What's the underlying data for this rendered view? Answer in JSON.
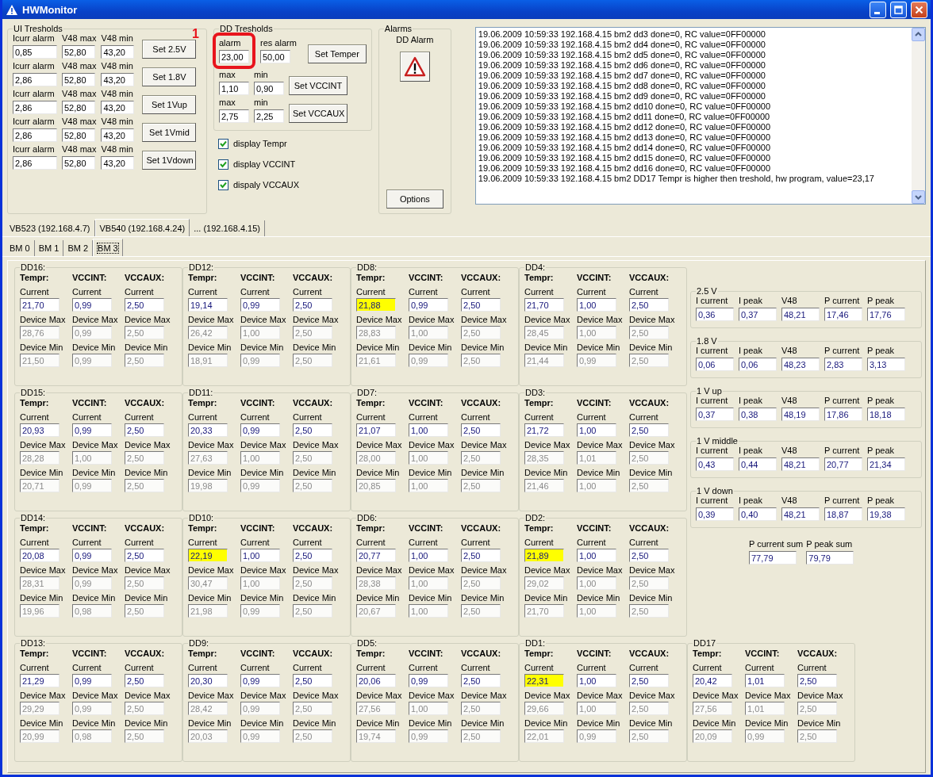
{
  "window": {
    "title": "HWMonitor"
  },
  "ui_thresholds": {
    "title": "UI Tresholds",
    "rows": [
      {
        "labels": [
          "Icurr alarm",
          "V48 max",
          "V48 min"
        ],
        "values": [
          "0,85",
          "52,80",
          "43,20"
        ],
        "button": "Set 2.5V"
      },
      {
        "labels": [
          "Icurr alarm",
          "V48 max",
          "V48 min"
        ],
        "values": [
          "2,86",
          "52,80",
          "43,20"
        ],
        "button": "Set 1.8V"
      },
      {
        "labels": [
          "Icurr alarm",
          "V48 max",
          "V48 min"
        ],
        "values": [
          "2,86",
          "52,80",
          "43,20"
        ],
        "button": "Set 1Vup"
      },
      {
        "labels": [
          "Icurr alarm",
          "V48 max",
          "V48 min"
        ],
        "values": [
          "2,86",
          "52,80",
          "43,20"
        ],
        "button": "Set 1Vmid"
      },
      {
        "labels": [
          "Icurr alarm",
          "V48 max",
          "V48 min"
        ],
        "values": [
          "2,86",
          "52,80",
          "43,20"
        ],
        "button": "Set 1Vdown"
      }
    ]
  },
  "dd_thresholds": {
    "title": "DD Tresholds",
    "annotation": "1",
    "rows": [
      {
        "labels": [
          "alarm",
          "res alarm"
        ],
        "values": [
          "23,00",
          "50,00"
        ],
        "button": "Set Temper"
      },
      {
        "labels": [
          "max",
          "min"
        ],
        "values": [
          "1,10",
          "0,90"
        ],
        "button": "Set VCCINT"
      },
      {
        "labels": [
          "max",
          "min"
        ],
        "values": [
          "2,75",
          "2,25"
        ],
        "button": "Set VCCAUX"
      }
    ]
  },
  "checkboxes": [
    {
      "label": "display Tempr",
      "checked": true
    },
    {
      "label": "display VCCINT",
      "checked": true
    },
    {
      "label": "dispaly VCCAUX",
      "checked": true
    }
  ],
  "alarms": {
    "title": "Alarms",
    "label": "DD Alarm",
    "button": "Options"
  },
  "log": {
    "lines": [
      "19.06.2009 10:59:33 192.168.4.15 bm2 dd3 done=0, RC value=0FF00000",
      "19.06.2009 10:59:33 192.168.4.15 bm2 dd4 done=0, RC value=0FF00000",
      "19.06.2009 10:59:33 192.168.4.15 bm2 dd5 done=0, RC value=0FF00000",
      "19.06.2009 10:59:33 192.168.4.15 bm2 dd6 done=0, RC value=0FF00000",
      "19.06.2009 10:59:33 192.168.4.15 bm2 dd7 done=0, RC value=0FF00000",
      "19.06.2009 10:59:33 192.168.4.15 bm2 dd8 done=0, RC value=0FF00000",
      "19.06.2009 10:59:33 192.168.4.15 bm2 dd9 done=0, RC value=0FF00000",
      "19.06.2009 10:59:33 192.168.4.15 bm2 dd10 done=0, RC value=0FF00000",
      "19.06.2009 10:59:33 192.168.4.15 bm2 dd11 done=0, RC value=0FF00000",
      "19.06.2009 10:59:33 192.168.4.15 bm2 dd12 done=0, RC value=0FF00000",
      "19.06.2009 10:59:33 192.168.4.15 bm2 dd13 done=0, RC value=0FF00000",
      "19.06.2009 10:59:33 192.168.4.15 bm2 dd14 done=0, RC value=0FF00000",
      "19.06.2009 10:59:33 192.168.4.15 bm2 dd15 done=0, RC value=0FF00000",
      "19.06.2009 10:59:33 192.168.4.15 bm2 dd16 done=0, RC value=0FF00000",
      "19.06.2009 10:59:33 192.168.4.15 bm2 DD17 Tempr is higher then treshold, hw program, value=23,17"
    ]
  },
  "tabs": [
    {
      "label": "VB523 (192.168.4.7)",
      "selected": false
    },
    {
      "label": "VB540 (192.168.4.24)",
      "selected": true
    },
    {
      "label": "... (192.168.4.15)",
      "selected": false
    }
  ],
  "subtabs": [
    {
      "label": "BM 0",
      "selected": false
    },
    {
      "label": "BM 1",
      "selected": false
    },
    {
      "label": "BM 2",
      "selected": false
    },
    {
      "label": "BM 3",
      "selected": true
    }
  ],
  "devices": [
    {
      "name": "DD16:",
      "metrics": [
        {
          "header": "Tempr:",
          "labels": [
            "Current",
            "Device Max",
            "Device Min"
          ],
          "values": [
            "21,70",
            "28,76",
            "21,50"
          ],
          "alarm": false
        },
        {
          "header": "VCCINT:",
          "labels": [
            "Current",
            "Device Max",
            "Device Min"
          ],
          "values": [
            "0,99",
            "0,99",
            "0,99"
          ],
          "alarm": false
        },
        {
          "header": "VCCAUX:",
          "labels": [
            "Current",
            "Device Max",
            "Device Min"
          ],
          "values": [
            "2,50",
            "2,50",
            "2,50"
          ],
          "alarm": false
        }
      ]
    },
    {
      "name": "DD12:",
      "metrics": [
        {
          "header": "Tempr:",
          "labels": [
            "Current",
            "Device Max",
            "Device Min"
          ],
          "values": [
            "19,14",
            "26,42",
            "18,91"
          ],
          "alarm": false
        },
        {
          "header": "VCCINT:",
          "labels": [
            "Current",
            "Device Max",
            "Device Min"
          ],
          "values": [
            "0,99",
            "1,00",
            "0,99"
          ],
          "alarm": false
        },
        {
          "header": "VCCAUX:",
          "labels": [
            "Current",
            "Device Max",
            "Device Min"
          ],
          "values": [
            "2,50",
            "2,50",
            "2,50"
          ],
          "alarm": false
        }
      ]
    },
    {
      "name": "DD8:",
      "metrics": [
        {
          "header": "Tempr:",
          "labels": [
            "Current",
            "Device Max",
            "Device Min"
          ],
          "values": [
            "21,88",
            "28,83",
            "21,61"
          ],
          "alarm": true
        },
        {
          "header": "VCCINT:",
          "labels": [
            "Current",
            "Device Max",
            "Device Min"
          ],
          "values": [
            "0,99",
            "1,00",
            "0,99"
          ],
          "alarm": false
        },
        {
          "header": "VCCAUX:",
          "labels": [
            "Current",
            "Device Max",
            "Device Min"
          ],
          "values": [
            "2,50",
            "2,50",
            "2,50"
          ],
          "alarm": false
        }
      ]
    },
    {
      "name": "DD4:",
      "metrics": [
        {
          "header": "Tempr:",
          "labels": [
            "Current",
            "Device Max",
            "Device Min"
          ],
          "values": [
            "21,70",
            "28,45",
            "21,44"
          ],
          "alarm": false
        },
        {
          "header": "VCCINT:",
          "labels": [
            "Current",
            "Device Max",
            "Device Min"
          ],
          "values": [
            "1,00",
            "1,00",
            "0,99"
          ],
          "alarm": false
        },
        {
          "header": "VCCAUX:",
          "labels": [
            "Current",
            "Device Max",
            "Device Min"
          ],
          "values": [
            "2,50",
            "2,50",
            "2,50"
          ],
          "alarm": false
        }
      ]
    },
    {
      "name": "DD15:",
      "metrics": [
        {
          "header": "Tempr:",
          "labels": [
            "Current",
            "Device Max",
            "Device Min"
          ],
          "values": [
            "20,93",
            "28,28",
            "20,71"
          ],
          "alarm": false
        },
        {
          "header": "VCCINT:",
          "labels": [
            "Current",
            "Device Max",
            "Device Min"
          ],
          "values": [
            "0,99",
            "1,00",
            "0,99"
          ],
          "alarm": false
        },
        {
          "header": "VCCAUX:",
          "labels": [
            "Current",
            "Device Max",
            "Device Min"
          ],
          "values": [
            "2,50",
            "2,50",
            "2,50"
          ],
          "alarm": false
        }
      ]
    },
    {
      "name": "DD11:",
      "metrics": [
        {
          "header": "Tempr:",
          "labels": [
            "Current",
            "Device Max",
            "Device Min"
          ],
          "values": [
            "20,33",
            "27,63",
            "19,98"
          ],
          "alarm": false
        },
        {
          "header": "VCCINT:",
          "labels": [
            "Current",
            "Device Max",
            "Device Min"
          ],
          "values": [
            "0,99",
            "1,00",
            "0,99"
          ],
          "alarm": false
        },
        {
          "header": "VCCAUX:",
          "labels": [
            "Current",
            "Device Max",
            "Device Min"
          ],
          "values": [
            "2,50",
            "2,50",
            "2,50"
          ],
          "alarm": false
        }
      ]
    },
    {
      "name": "DD7:",
      "metrics": [
        {
          "header": "Tempr:",
          "labels": [
            "Current",
            "Device Max",
            "Device Min"
          ],
          "values": [
            "21,07",
            "28,00",
            "20,85"
          ],
          "alarm": false
        },
        {
          "header": "VCCINT:",
          "labels": [
            "Current",
            "Device Max",
            "Device Min"
          ],
          "values": [
            "1,00",
            "1,00",
            "1,00"
          ],
          "alarm": false
        },
        {
          "header": "VCCAUX:",
          "labels": [
            "Current",
            "Device Max",
            "Device Min"
          ],
          "values": [
            "2,50",
            "2,50",
            "2,50"
          ],
          "alarm": false
        }
      ]
    },
    {
      "name": "DD3:",
      "metrics": [
        {
          "header": "Tempr:",
          "labels": [
            "Current",
            "Device Max",
            "Device Min"
          ],
          "values": [
            "21,72",
            "28,35",
            "21,46"
          ],
          "alarm": false
        },
        {
          "header": "VCCINT:",
          "labels": [
            "Current",
            "Device Max",
            "Device Min"
          ],
          "values": [
            "1,00",
            "1,01",
            "1,00"
          ],
          "alarm": false
        },
        {
          "header": "VCCAUX:",
          "labels": [
            "Current",
            "Device Max",
            "Device Min"
          ],
          "values": [
            "2,50",
            "2,50",
            "2,50"
          ],
          "alarm": false
        }
      ]
    },
    {
      "name": "DD14:",
      "metrics": [
        {
          "header": "Tempr:",
          "labels": [
            "Current",
            "Device Max",
            "Device Min"
          ],
          "values": [
            "20,08",
            "28,31",
            "19,96"
          ],
          "alarm": false
        },
        {
          "header": "VCCINT:",
          "labels": [
            "Current",
            "Device Max",
            "Device Min"
          ],
          "values": [
            "0,99",
            "0,99",
            "0,98"
          ],
          "alarm": false
        },
        {
          "header": "VCCAUX:",
          "labels": [
            "Current",
            "Device Max",
            "Device Min"
          ],
          "values": [
            "2,50",
            "2,50",
            "2,50"
          ],
          "alarm": false
        }
      ]
    },
    {
      "name": "DD10:",
      "metrics": [
        {
          "header": "Tempr:",
          "labels": [
            "Current",
            "Device Max",
            "Device Min"
          ],
          "values": [
            "22,19",
            "30,47",
            "21,98"
          ],
          "alarm": true
        },
        {
          "header": "VCCINT:",
          "labels": [
            "Current",
            "Device Max",
            "Device Min"
          ],
          "values": [
            "1,00",
            "1,00",
            "0,99"
          ],
          "alarm": false
        },
        {
          "header": "VCCAUX:",
          "labels": [
            "Current",
            "Device Max",
            "Device Min"
          ],
          "values": [
            "2,50",
            "2,50",
            "2,50"
          ],
          "alarm": false
        }
      ]
    },
    {
      "name": "DD6:",
      "metrics": [
        {
          "header": "Tempr:",
          "labels": [
            "Current",
            "Device Max",
            "Device Min"
          ],
          "values": [
            "20,77",
            "28,38",
            "20,67"
          ],
          "alarm": false
        },
        {
          "header": "VCCINT:",
          "labels": [
            "Current",
            "Device Max",
            "Device Min"
          ],
          "values": [
            "1,00",
            "1,00",
            "1,00"
          ],
          "alarm": false
        },
        {
          "header": "VCCAUX:",
          "labels": [
            "Current",
            "Device Max",
            "Device Min"
          ],
          "values": [
            "2,50",
            "2,50",
            "2,50"
          ],
          "alarm": false
        }
      ]
    },
    {
      "name": "DD2:",
      "metrics": [
        {
          "header": "Tempr:",
          "labels": [
            "Current",
            "Device Max",
            "Device Min"
          ],
          "values": [
            "21,89",
            "29,02",
            "21,70"
          ],
          "alarm": true
        },
        {
          "header": "VCCINT:",
          "labels": [
            "Current",
            "Device Max",
            "Device Min"
          ],
          "values": [
            "1,00",
            "1,00",
            "1,00"
          ],
          "alarm": false
        },
        {
          "header": "VCCAUX:",
          "labels": [
            "Current",
            "Device Max",
            "Device Min"
          ],
          "values": [
            "2,50",
            "2,50",
            "2,50"
          ],
          "alarm": false
        }
      ]
    },
    {
      "name": "DD13:",
      "metrics": [
        {
          "header": "Tempr:",
          "labels": [
            "Current",
            "Device Max",
            "Device Min"
          ],
          "values": [
            "21,29",
            "29,29",
            "20,99"
          ],
          "alarm": false
        },
        {
          "header": "VCCINT:",
          "labels": [
            "Current",
            "Device Max",
            "Device Min"
          ],
          "values": [
            "0,99",
            "0,99",
            "0,98"
          ],
          "alarm": false
        },
        {
          "header": "VCCAUX:",
          "labels": [
            "Current",
            "Device Max",
            "Device Min"
          ],
          "values": [
            "2,50",
            "2,50",
            "2,50"
          ],
          "alarm": false
        }
      ]
    },
    {
      "name": "DD9:",
      "metrics": [
        {
          "header": "Tempr:",
          "labels": [
            "Current",
            "Device Max",
            "Device Min"
          ],
          "values": [
            "20,30",
            "28,42",
            "20,03"
          ],
          "alarm": false
        },
        {
          "header": "VCCINT:",
          "labels": [
            "Current",
            "Device Max",
            "Device Min"
          ],
          "values": [
            "0,99",
            "0,99",
            "0,99"
          ],
          "alarm": false
        },
        {
          "header": "VCCAUX:",
          "labels": [
            "Current",
            "Device Max",
            "Device Min"
          ],
          "values": [
            "2,50",
            "2,50",
            "2,50"
          ],
          "alarm": false
        }
      ]
    },
    {
      "name": "DD5:",
      "metrics": [
        {
          "header": "Tempr:",
          "labels": [
            "Current",
            "Device Max",
            "Device Min"
          ],
          "values": [
            "20,06",
            "27,56",
            "19,74"
          ],
          "alarm": false
        },
        {
          "header": "VCCINT:",
          "labels": [
            "Current",
            "Device Max",
            "Device Min"
          ],
          "values": [
            "0,99",
            "1,00",
            "0,99"
          ],
          "alarm": false
        },
        {
          "header": "VCCAUX:",
          "labels": [
            "Current",
            "Device Max",
            "Device Min"
          ],
          "values": [
            "2,50",
            "2,50",
            "2,50"
          ],
          "alarm": false
        }
      ]
    },
    {
      "name": "DD1:",
      "metrics": [
        {
          "header": "Tempr:",
          "labels": [
            "Current",
            "Device Max",
            "Device Min"
          ],
          "values": [
            "22,31",
            "29,66",
            "22,01"
          ],
          "alarm": true
        },
        {
          "header": "VCCINT:",
          "labels": [
            "Current",
            "Device Max",
            "Device Min"
          ],
          "values": [
            "1,00",
            "1,00",
            "0,99"
          ],
          "alarm": false
        },
        {
          "header": "VCCAUX:",
          "labels": [
            "Current",
            "Device Max",
            "Device Min"
          ],
          "values": [
            "2,50",
            "2,50",
            "2,50"
          ],
          "alarm": false
        }
      ]
    },
    {
      "name": "DD17",
      "metrics": [
        {
          "header": "Tempr:",
          "labels": [
            "Current",
            "Device Max",
            "Device Min"
          ],
          "values": [
            "20,42",
            "27,56",
            "20,09"
          ],
          "alarm": false
        },
        {
          "header": "VCCINT:",
          "labels": [
            "Current",
            "Device Max",
            "Device Min"
          ],
          "values": [
            "1,01",
            "1,01",
            "0,99"
          ],
          "alarm": false
        },
        {
          "header": "VCCAUX:",
          "labels": [
            "Current",
            "Device Max",
            "Device Min"
          ],
          "values": [
            "2,50",
            "2,50",
            "2,50"
          ],
          "alarm": false
        }
      ]
    }
  ],
  "power": {
    "groups": [
      {
        "title": "2.5 V",
        "fields": [
          {
            "label": "I current",
            "value": "0,36"
          },
          {
            "label": "I peak",
            "value": "0,37"
          },
          {
            "label": "V48",
            "value": "48,21"
          },
          {
            "label": "P current",
            "value": "17,46"
          },
          {
            "label": "P peak",
            "value": "17,76"
          }
        ]
      },
      {
        "title": "1.8 V",
        "fields": [
          {
            "label": "I current",
            "value": "0,06"
          },
          {
            "label": "I peak",
            "value": "0,06"
          },
          {
            "label": "V48",
            "value": "48,23"
          },
          {
            "label": "P current",
            "value": "2,83"
          },
          {
            "label": "P peak",
            "value": "3,13"
          }
        ]
      },
      {
        "title": "1 V up",
        "fields": [
          {
            "label": "I current",
            "value": "0,37"
          },
          {
            "label": "I peak",
            "value": "0,38"
          },
          {
            "label": "V48",
            "value": "48,19"
          },
          {
            "label": "P current",
            "value": "17,86"
          },
          {
            "label": "P peak",
            "value": "18,18"
          }
        ]
      },
      {
        "title": "1 V middle",
        "fields": [
          {
            "label": "I current",
            "value": "0,43"
          },
          {
            "label": "I peak",
            "value": "0,44"
          },
          {
            "label": "V48",
            "value": "48,21"
          },
          {
            "label": "P current",
            "value": "20,77"
          },
          {
            "label": "P peak",
            "value": "21,34"
          }
        ]
      },
      {
        "title": "1 V down",
        "fields": [
          {
            "label": "I current",
            "value": "0,39"
          },
          {
            "label": "I peak",
            "value": "0,40"
          },
          {
            "label": "V48",
            "value": "48,21"
          },
          {
            "label": "P current",
            "value": "18,87"
          },
          {
            "label": "P peak",
            "value": "19,38"
          }
        ]
      }
    ],
    "sums": [
      {
        "label": "P current sum",
        "value": "77,79"
      },
      {
        "label": "P peak sum",
        "value": "79,79"
      }
    ]
  }
}
